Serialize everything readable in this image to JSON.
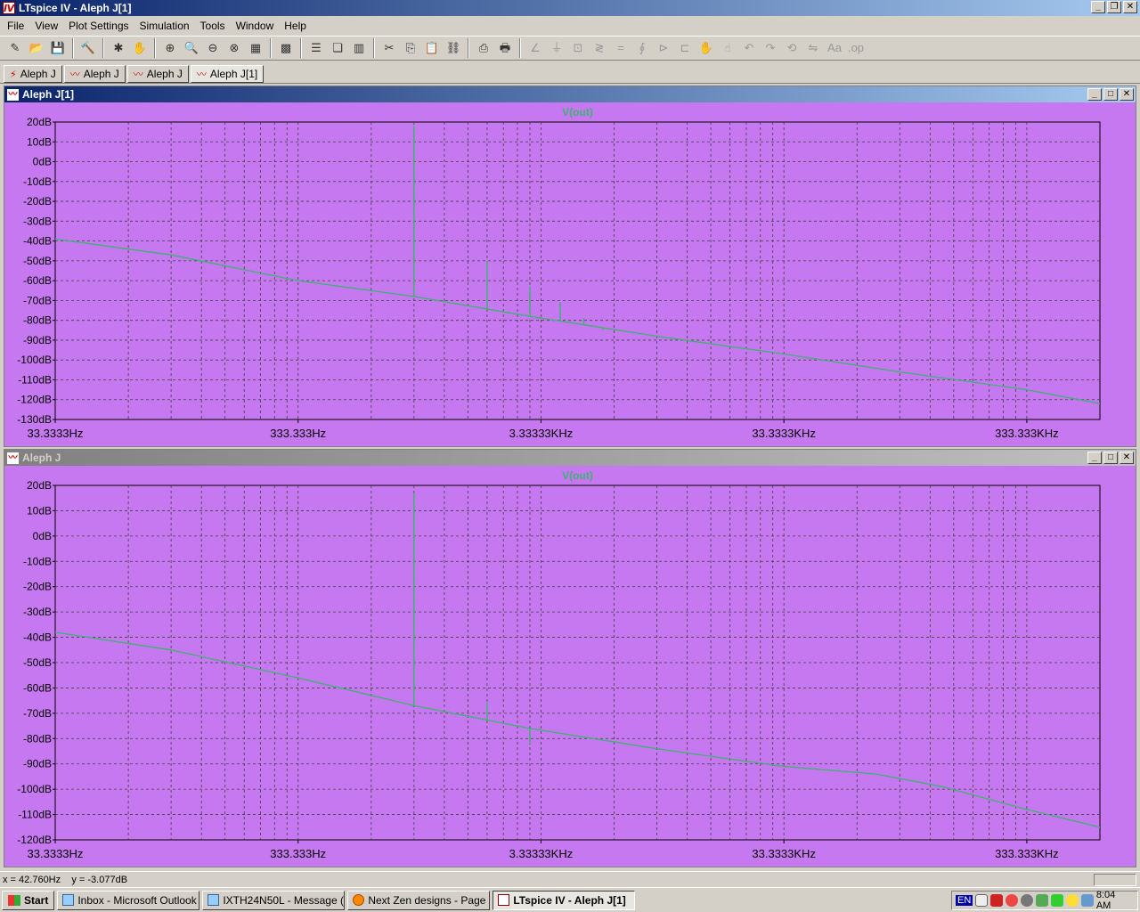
{
  "window": {
    "title": "LTspice IV - Aleph J[1]",
    "icon": "ltspice-logo-icon"
  },
  "menu": [
    "File",
    "View",
    "Plot Settings",
    "Simulation",
    "Tools",
    "Window",
    "Help"
  ],
  "toolbar_icons": [
    "new-schematic-icon",
    "open-icon",
    "save-icon",
    "control-panel-icon",
    "run-icon",
    "halt-icon",
    "zoom-in-icon",
    "zoom-area-icon",
    "zoom-out-icon",
    "zoom-fit-icon",
    "autorange-icon",
    "grid-icon",
    "tile-horizontal-icon",
    "cascade-icon",
    "tile-vertical-icon",
    "cut-icon",
    "copy-icon",
    "paste-icon",
    "find-icon",
    "print-setup-icon",
    "print-icon",
    "wire-icon",
    "ground-icon",
    "label-icon",
    "resistor-icon",
    "capacitor-icon",
    "inductor-icon",
    "diode-icon",
    "component-icon",
    "move-icon",
    "drag-icon",
    "undo-icon",
    "redo-icon",
    "rotate-icon",
    "mirror-icon",
    "text-icon",
    "spice-directive-icon"
  ],
  "tabs": [
    {
      "label": "Aleph J",
      "icon": "schematic-icon"
    },
    {
      "label": "Aleph J",
      "icon": "waveform-icon"
    },
    {
      "label": "Aleph J",
      "icon": "waveform-icon"
    },
    {
      "label": "Aleph J[1]",
      "icon": "waveform-icon"
    }
  ],
  "colors": {
    "plot_bg": "#c678f0",
    "trace": "#3cb371",
    "grid": "#404040"
  },
  "chart_data": [
    {
      "type": "line",
      "window_title": "Aleph J[1]",
      "title": "V(out)",
      "xlabel": "",
      "ylabel": "",
      "x_scale": "log",
      "xlim_hz": [
        33.3333,
        666666
      ],
      "ylim": [
        -130,
        20
      ],
      "y_ticks": [
        "20dB",
        "10dB",
        "0dB",
        "-10dB",
        "-20dB",
        "-30dB",
        "-40dB",
        "-50dB",
        "-60dB",
        "-70dB",
        "-80dB",
        "-90dB",
        "-100dB",
        "-110dB",
        "-120dB",
        "-130dB"
      ],
      "y_tick_values": [
        20,
        10,
        0,
        -10,
        -20,
        -30,
        -40,
        -50,
        -60,
        -70,
        -80,
        -90,
        -100,
        -110,
        -120,
        -130
      ],
      "x_ticks": [
        "33.3333Hz",
        "333.333Hz",
        "3.33333KHz",
        "33.3333KHz",
        "333.333KHz"
      ],
      "x_tick_values": [
        33.3333,
        333.333,
        3333.33,
        33333.3,
        333333
      ],
      "grid": true,
      "series": [
        {
          "baseline": [
            [
              33.3333,
              -39
            ],
            [
              100,
              -47
            ],
            [
              333,
              -60
            ],
            [
              1000,
              -68
            ],
            [
              3000,
              -78
            ],
            [
              10000,
              -88
            ],
            [
              33333,
              -97
            ],
            [
              100000,
              -106
            ],
            [
              333333,
              -115
            ],
            [
              666666,
              -122
            ]
          ],
          "spikes": [
            [
              1000,
              18
            ],
            [
              2000,
              -50
            ],
            [
              3000,
              -63
            ],
            [
              4000,
              -71
            ],
            [
              5000,
              -79
            ],
            [
              6000,
              -85
            ]
          ]
        }
      ]
    },
    {
      "type": "line",
      "window_title": "Aleph J",
      "title": "V(out)",
      "xlabel": "",
      "ylabel": "",
      "x_scale": "log",
      "xlim_hz": [
        33.3333,
        666666
      ],
      "ylim": [
        -120,
        20
      ],
      "y_ticks": [
        "20dB",
        "10dB",
        "0dB",
        "-10dB",
        "-20dB",
        "-30dB",
        "-40dB",
        "-50dB",
        "-60dB",
        "-70dB",
        "-80dB",
        "-90dB",
        "-100dB",
        "-110dB",
        "-120dB"
      ],
      "y_tick_values": [
        20,
        10,
        0,
        -10,
        -20,
        -30,
        -40,
        -50,
        -60,
        -70,
        -80,
        -90,
        -100,
        -110,
        -120
      ],
      "x_ticks": [
        "33.3333Hz",
        "333.333Hz",
        "3.33333KHz",
        "33.3333KHz",
        "333.333KHz"
      ],
      "x_tick_values": [
        33.3333,
        333.333,
        3333.33,
        33333.3,
        333333
      ],
      "grid": true,
      "series": [
        {
          "baseline": [
            [
              33.3333,
              -38
            ],
            [
              100,
              -45
            ],
            [
              333,
              -56
            ],
            [
              1000,
              -67
            ],
            [
              3000,
              -76
            ],
            [
              10000,
              -84
            ],
            [
              33333,
              -91
            ],
            [
              80000,
              -94
            ],
            [
              150000,
              -99
            ],
            [
              333333,
              -108
            ],
            [
              666666,
              -115
            ]
          ],
          "spikes": [
            [
              1000,
              17
            ],
            [
              2000,
              -66
            ],
            [
              3000,
              -82
            ]
          ]
        }
      ]
    }
  ],
  "status": {
    "cursor": "x = 42.760Hz    y = -3.077dB"
  },
  "taskbar": {
    "start": "Start",
    "tasks": [
      "Inbox - Microsoft Outlook",
      "IXTH24N50L - Message (...",
      "Next Zen designs - Page ...",
      "LTspice IV - Aleph J[1]"
    ],
    "active_task": 3,
    "tray_lang": "EN",
    "clock": "8:04 AM"
  }
}
